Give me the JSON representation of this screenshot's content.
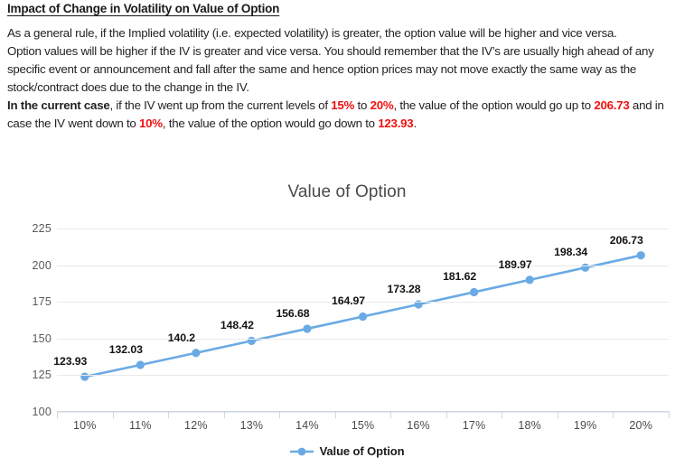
{
  "article": {
    "heading": "Impact of Change in Volatility on Value of Option",
    "para1": "As a general rule, if the Implied volatility (i.e. expected volatility) is greater, the option value will be higher and vice versa.",
    "para2": "Option values will be higher if the IV is greater and vice versa. You should remember that the IV’s are usually high ahead of any specific event or announcement and fall after the same and hence option prices may not move exactly the same way as the stock/contract does due to the change in the IV.",
    "para3": {
      "lead": "In the current case",
      "t1": ", if the IV went up from the current levels of ",
      "r1": "15%",
      "t2": " to ",
      "r2": "20%",
      "t3": ", the value of the option would go up to ",
      "r3": "206.73",
      "t4": " and in case the IV went down to ",
      "r4": "10%",
      "t5": ", the value of the option would go down to ",
      "r5": "123.93",
      "t6": "."
    },
    "highlight_color": "#f01010"
  },
  "chart_data": {
    "type": "line",
    "title": "Value of Option",
    "xlabel": "",
    "ylabel": "",
    "categories": [
      "10%",
      "11%",
      "12%",
      "13%",
      "14%",
      "15%",
      "16%",
      "17%",
      "18%",
      "19%",
      "20%"
    ],
    "series": [
      {
        "name": "Value of Option",
        "values": [
          123.93,
          132.03,
          140.2,
          148.42,
          156.68,
          164.97,
          173.28,
          181.62,
          189.97,
          198.34,
          206.73
        ],
        "color": "#6aaae4",
        "marker": "circle",
        "data_labels": [
          "123.93",
          "132.03",
          "140.2",
          "148.42",
          "156.68",
          "164.97",
          "173.28",
          "181.62",
          "189.97",
          "198.34",
          "206.73"
        ]
      }
    ],
    "ylim": [
      100,
      225
    ],
    "yticks": [
      100,
      125,
      150,
      175,
      200,
      225
    ],
    "ytick_labels": [
      "100",
      "125",
      "150",
      "175",
      "200",
      "225"
    ],
    "grid": true,
    "legend": {
      "position": "bottom",
      "entries": [
        "Value of Option"
      ]
    },
    "axis_color": "#cdd8e4",
    "grid_color": "#e9e9e9"
  }
}
